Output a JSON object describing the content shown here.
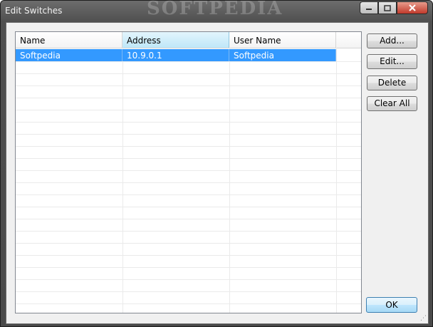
{
  "window": {
    "title": "Edit Switches",
    "watermark": "SOFTPEDIA"
  },
  "table": {
    "columns": [
      "Name",
      "Address",
      "User Name"
    ],
    "rows": [
      {
        "name": "Softpedia",
        "address": "10.9.0.1",
        "user": "Softpedia",
        "selected": true
      }
    ]
  },
  "buttons": {
    "add": "Add...",
    "edit": "Edit...",
    "delete": "Delete",
    "clear_all": "Clear All",
    "ok": "OK"
  },
  "colors": {
    "selection": "#3399ff",
    "header_hot": "#bfe7f8",
    "ok_border": "#3c7fb1"
  },
  "icons": {
    "minimize": "minimize-icon",
    "maximize": "maximize-icon",
    "close": "close-icon",
    "resize": "resize-grip-icon"
  }
}
